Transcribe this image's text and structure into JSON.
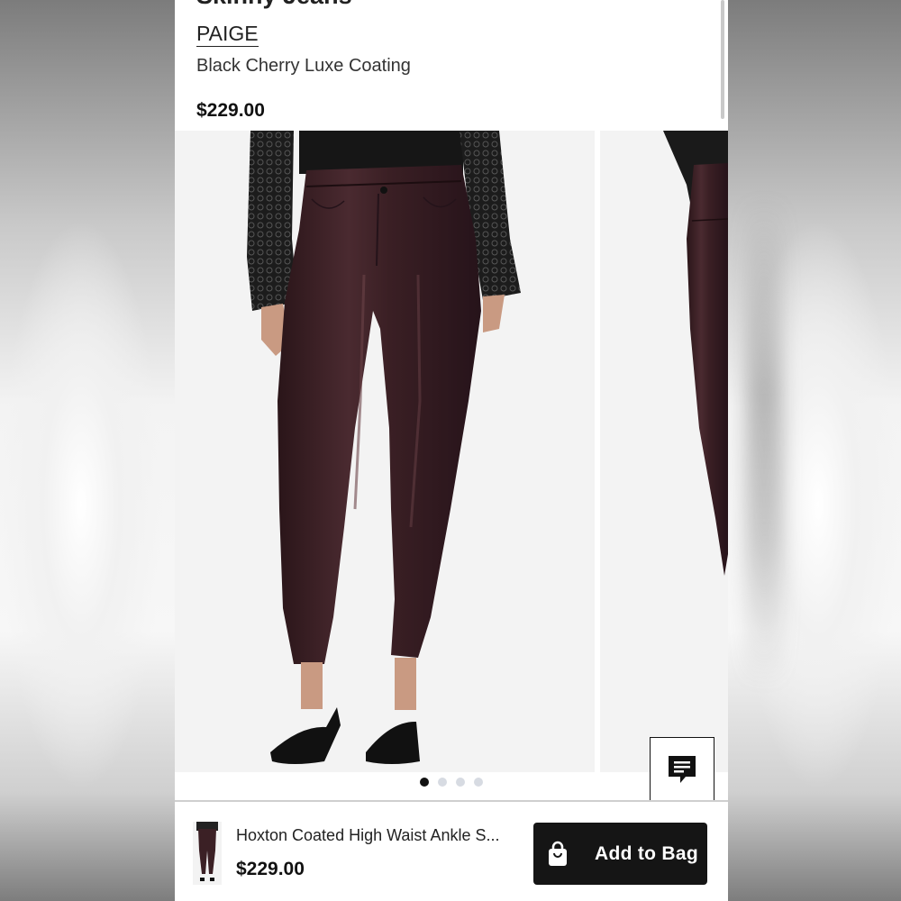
{
  "product": {
    "title": "Skinny Jeans",
    "brand": "PAIGE",
    "color_name": "Black Cherry Luxe Coating",
    "price": "$229.00"
  },
  "gallery": {
    "image_count": 4,
    "active_index": 0
  },
  "bottom_bar": {
    "product_name": "Hoxton Coated High Waist Ankle S...",
    "price": "$229.00",
    "add_to_bag_label": "Add to Bag"
  },
  "icons": {
    "chat": "chat-bubble-icon",
    "bag": "shopping-bag-icon"
  },
  "colors": {
    "accent": "#151515",
    "pant": "#3b2025",
    "dot_inactive": "#d7dbe2"
  }
}
